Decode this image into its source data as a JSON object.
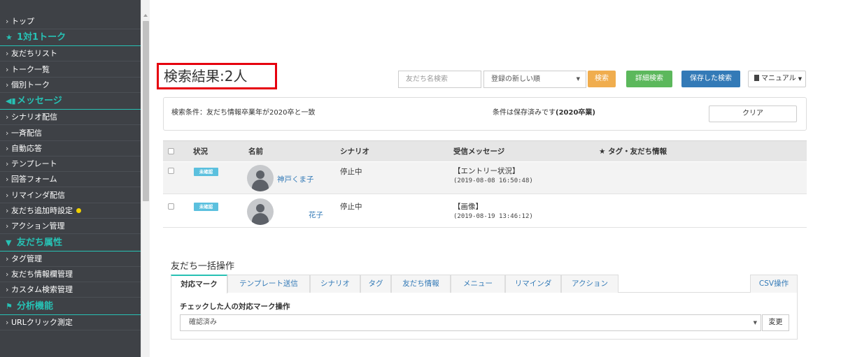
{
  "sidebar": {
    "items": [
      {
        "type": "item",
        "label": "トップ"
      },
      {
        "type": "head",
        "label": "1対1トーク",
        "icon": "★"
      },
      {
        "type": "item",
        "label": "友だちリスト"
      },
      {
        "type": "item",
        "label": "トーク一覧"
      },
      {
        "type": "item",
        "label": "個別トーク"
      },
      {
        "type": "head",
        "label": "メッセージ",
        "icon": "◀▮"
      },
      {
        "type": "item",
        "label": "シナリオ配信"
      },
      {
        "type": "item",
        "label": "一斉配信"
      },
      {
        "type": "item",
        "label": "自動応答"
      },
      {
        "type": "item",
        "label": "テンプレート"
      },
      {
        "type": "item",
        "label": "回答フォーム"
      },
      {
        "type": "item",
        "label": "リマインダ配信"
      },
      {
        "type": "item",
        "label": "友だち追加時設定",
        "dot": true
      },
      {
        "type": "item",
        "label": "アクション管理"
      },
      {
        "type": "head",
        "label": "友だち属性",
        "icon": "▼"
      },
      {
        "type": "item",
        "label": "タグ管理"
      },
      {
        "type": "item",
        "label": "友だち情報欄管理"
      },
      {
        "type": "item",
        "label": "カスタム検索管理"
      },
      {
        "type": "head",
        "label": "分析機能",
        "icon": "⚑"
      },
      {
        "type": "item",
        "label": "URLクリック測定"
      }
    ]
  },
  "header": {
    "title": "検索結果:2人",
    "search_placeholder": "友だち名検索",
    "sort_value": "登録の新しい順",
    "search_label": "検索",
    "advanced_label": "詳細検索",
    "saved_label": "保存した検索",
    "manual_label": "マニュアル"
  },
  "conditions": {
    "text": "検索条件：友だち情報卒業年が2020卒と一致",
    "saved_prefix": "条件は保存済みです",
    "saved_name": "(2020卒業)",
    "clear_label": "クリア"
  },
  "table": {
    "headers": {
      "status": "状況",
      "name": "名前",
      "scenario": "シナリオ",
      "message": "受信メッセージ",
      "tags": "★ タグ・友だち情報"
    },
    "rows": [
      {
        "badge": "未確認",
        "name": "神戸くま子",
        "scenario": "停止中",
        "message": "【エントリー状況】",
        "time": "(2019-08-08 16:50:48)"
      },
      {
        "badge": "未確認",
        "name": "花子",
        "scenario": "停止中",
        "message": "【画像】",
        "time": "(2019-08-19 13:46:12)"
      }
    ]
  },
  "bulk": {
    "title": "友だち一括操作",
    "tabs": [
      "対応マーク",
      "テンプレート送信",
      "シナリオ",
      "タグ",
      "友だち情報",
      "メニュー",
      "リマインダ",
      "アクション"
    ],
    "csv_tab": "CSV操作",
    "subtitle": "チェックした人の対応マーク操作",
    "select_value": "確認済み",
    "change_label": "変更"
  },
  "colors": {
    "sidebar_bg": "#3e4146",
    "accent_teal": "#27c1b4",
    "title_border": "#e6000e",
    "search_btn": "#f0ad4e",
    "advanced_btn": "#5cb85c",
    "saved_btn": "#337ab7",
    "badge": "#5bc0de",
    "dot": "#f0d000"
  }
}
